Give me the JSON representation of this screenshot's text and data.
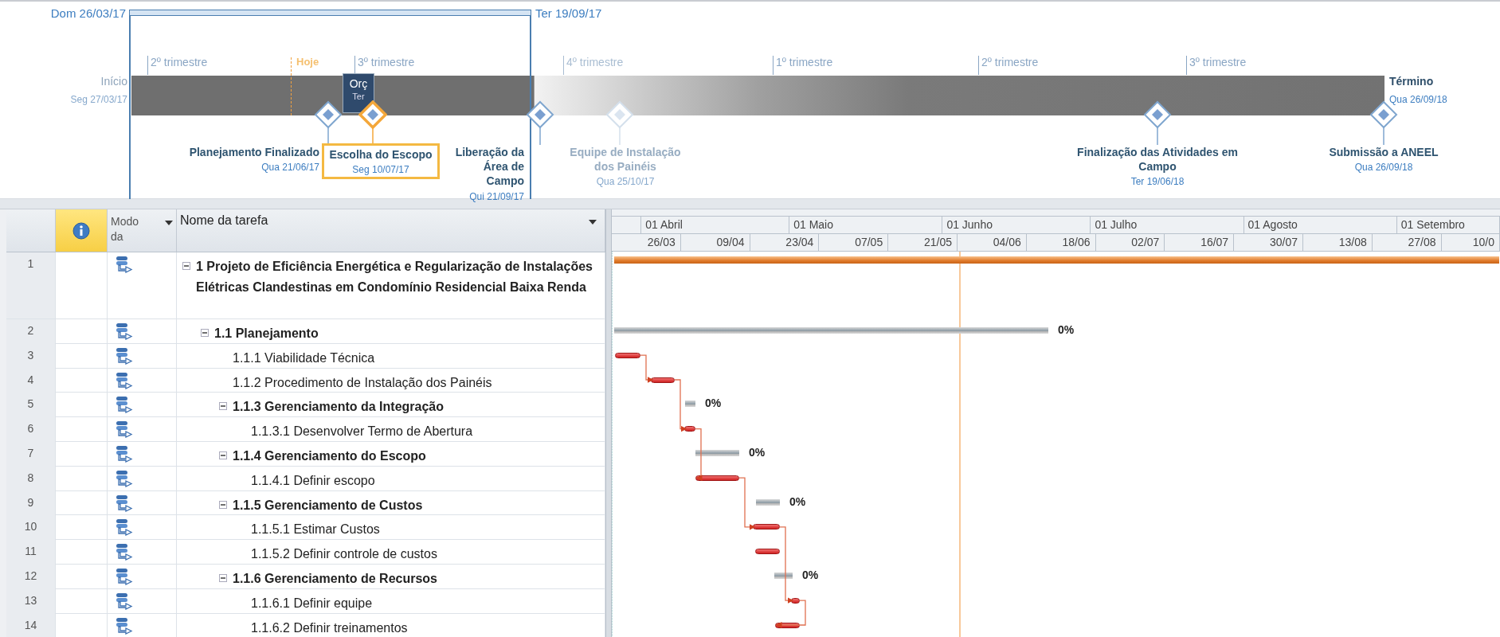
{
  "timeline": {
    "range_start": "Dom 26/03/17",
    "range_end": "Ter 19/09/17",
    "today": "Hoje",
    "start": {
      "label": "Início",
      "date": "Seg 27/03/17"
    },
    "finish": {
      "label": "Término",
      "date": "Qua 26/09/18"
    },
    "quarters": [
      {
        "label": "2º trimestre",
        "faded": false
      },
      {
        "label": "3º trimestre",
        "faded": false
      },
      {
        "label": "4º trimestre",
        "faded": true
      },
      {
        "label": "1º trimestre",
        "faded": false
      },
      {
        "label": "2º trimestre",
        "faded": false
      },
      {
        "label": "3º trimestre",
        "faded": false
      }
    ],
    "callout": {
      "label": "Orç",
      "date": "Ter"
    },
    "milestones": [
      {
        "name": "Planejamento Finalizado",
        "date": "Qua 21/06/17",
        "selected": false,
        "faded": false
      },
      {
        "name": "Escolha do Escopo",
        "date": "Seg 10/07/17",
        "selected": true,
        "faded": false
      },
      {
        "name": "Liberação da Área de Campo",
        "date": "Qui 21/09/17",
        "selected": false,
        "faded": false
      },
      {
        "name": "Equipe de Instalação dos Painéis",
        "date": "Qua 25/10/17",
        "selected": false,
        "faded": true
      },
      {
        "name": "Finalização das Atividades em Campo",
        "date": "Ter 19/06/18",
        "selected": false,
        "faded": false
      },
      {
        "name": "Submissão a ANEEL",
        "date": "Qua 26/09/18",
        "selected": false,
        "faded": false
      }
    ]
  },
  "table": {
    "columns": [
      "Modo da",
      "Nome da tarefa"
    ],
    "tasks": [
      {
        "id": "1",
        "name": "1 Projeto de Eficiência Energética e Regularização de Instalações Elétricas Clandestinas em Condomínio Residencial Baixa Renda",
        "expanded": true,
        "children": [
          {
            "id": "2",
            "name": "1.1 Planejamento",
            "expanded": true,
            "percent": "0%",
            "children": [
              {
                "id": "3",
                "name": "1.1.1 Viabilidade Técnica"
              },
              {
                "id": "4",
                "name": "1.1.2 Procedimento de Instalação dos Painéis"
              },
              {
                "id": "5",
                "name": "1.1.3 Gerenciamento da Integração",
                "expanded": true,
                "percent": "0%",
                "children": [
                  {
                    "id": "6",
                    "name": "1.1.3.1 Desenvolver Termo de Abertura"
                  }
                ]
              },
              {
                "id": "7",
                "name": "1.1.4 Gerenciamento do Escopo",
                "expanded": true,
                "percent": "0%",
                "children": [
                  {
                    "id": "8",
                    "name": "1.1.4.1 Definir escopo"
                  }
                ]
              },
              {
                "id": "9",
                "name": "1.1.5 Gerenciamento de Custos",
                "expanded": true,
                "percent": "0%",
                "children": [
                  {
                    "id": "10",
                    "name": "1.1.5.1 Estimar Custos"
                  },
                  {
                    "id": "11",
                    "name": "1.1.5.2 Definir controle de custos"
                  }
                ]
              },
              {
                "id": "12",
                "name": "1.1.6 Gerenciamento de Recursos",
                "expanded": true,
                "percent": "0%",
                "children": [
                  {
                    "id": "13",
                    "name": "1.1.6.1 Definir equipe"
                  },
                  {
                    "id": "14",
                    "name": "1.1.6.2 Definir treinamentos"
                  }
                ]
              }
            ]
          }
        ]
      }
    ]
  },
  "gantt": {
    "months": [
      "01 Abril",
      "01 Maio",
      "01 Junho",
      "01 Julho",
      "01 Agosto",
      "01 Setembro"
    ],
    "weeks": [
      "26/03",
      "09/04",
      "23/04",
      "07/05",
      "21/05",
      "04/06",
      "18/06",
      "02/07",
      "16/07",
      "30/07",
      "13/08",
      "27/08",
      "10/0"
    ]
  }
}
